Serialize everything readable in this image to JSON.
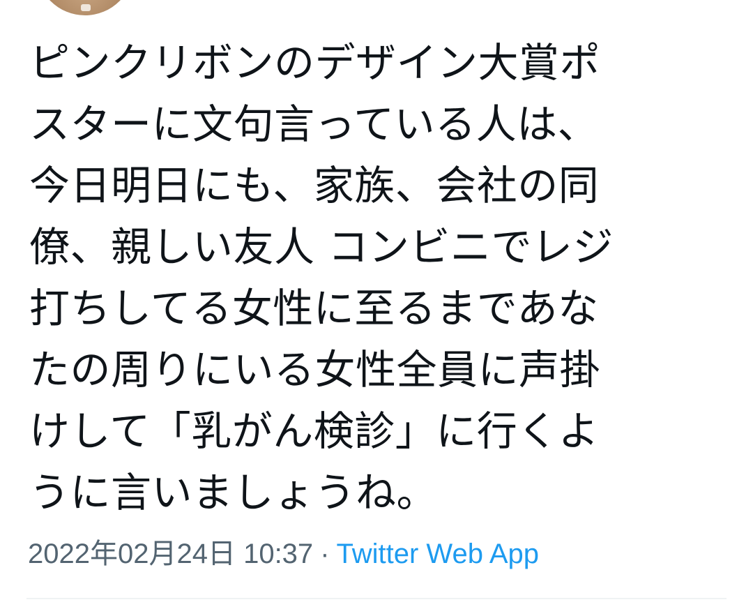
{
  "tweet": {
    "lines": [
      "ピンクリボンのデザイン大賞ポ",
      "スターに文句言っている人は、",
      "今日明日にも、家族、会社の同",
      "僚、親しい友人 コンビニでレジ",
      "打ちしてる女性に至るまであな",
      "たの周りにいる女性全員に声掛",
      "けして「乳がん検診」に行くよ",
      "うに言いましょうね。"
    ],
    "timestamp": "2022年02月24日 10:37",
    "separator": "·",
    "source_app": "Twitter Web App"
  },
  "colors": {
    "text": "#0f1419",
    "meta": "#536471",
    "link": "#1d9bf0",
    "divider": "#eff3f4"
  }
}
